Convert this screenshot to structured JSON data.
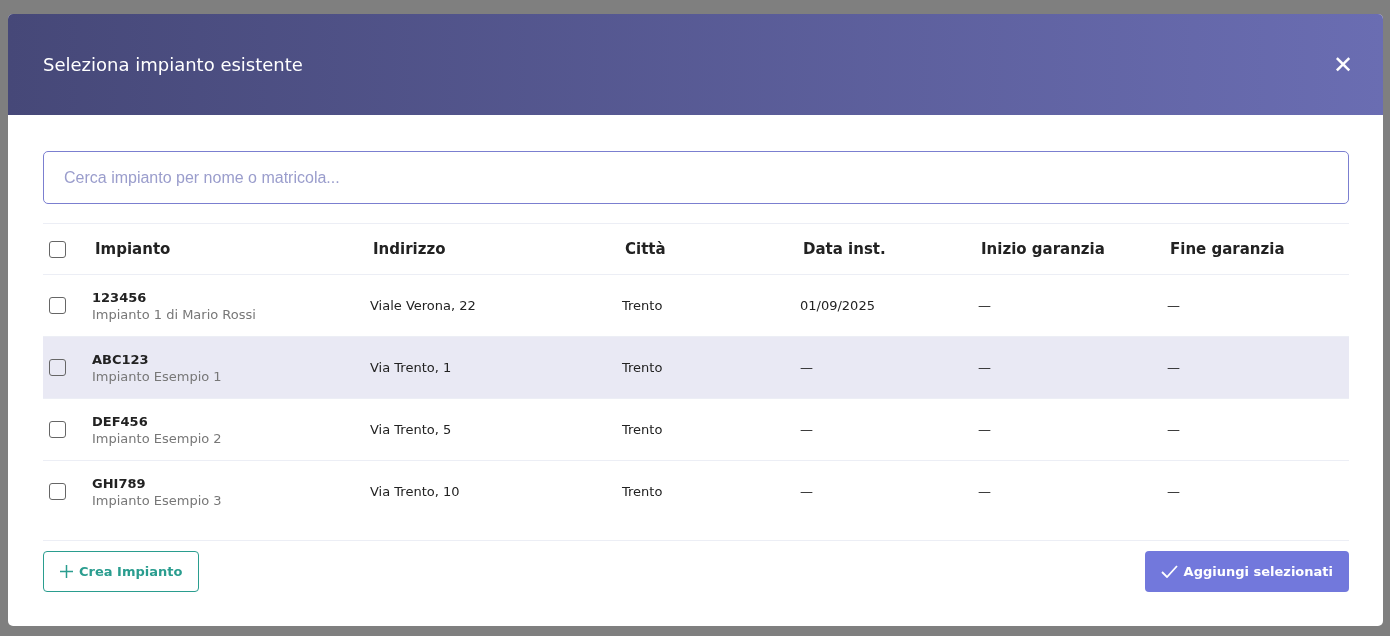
{
  "dialog": {
    "title": "Seleziona impianto esistente",
    "close": "✕"
  },
  "search": {
    "placeholder": "Cerca impianto per nome o matricola..."
  },
  "table": {
    "select_all": {
      "checked": false
    },
    "columns": [
      "Impianto",
      "Indirizzo",
      "Città",
      "Data inst.",
      "Inizio garanzia",
      "Fine garanzia"
    ],
    "rows": [
      {
        "code": "123456",
        "name": "Impianto 1 di Mario Rossi",
        "address": "Viale Verona, 22",
        "city": "Trento",
        "install_date": "01/09/2025",
        "warranty_start": "—",
        "warranty_end": "—",
        "checked": false,
        "highlighted": false
      },
      {
        "code": "ABC123",
        "name": "Impianto Esempio 1",
        "address": "Via Trento, 1",
        "city": "Trento",
        "install_date": "—",
        "warranty_start": "—",
        "warranty_end": "—",
        "checked": false,
        "highlighted": true
      },
      {
        "code": "DEF456",
        "name": "Impianto Esempio 2",
        "address": "Via Trento, 5",
        "city": "Trento",
        "install_date": "—",
        "warranty_start": "—",
        "warranty_end": "—",
        "checked": false,
        "highlighted": false
      },
      {
        "code": "GHI789",
        "name": "Impianto Esempio 3",
        "address": "Via Trento, 10",
        "city": "Trento",
        "install_date": "—",
        "warranty_start": "—",
        "warranty_end": "—",
        "checked": false,
        "highlighted": false
      }
    ]
  },
  "footer": {
    "create_button": "Crea Impianto",
    "add_button": "Aggiungi selezionati"
  }
}
